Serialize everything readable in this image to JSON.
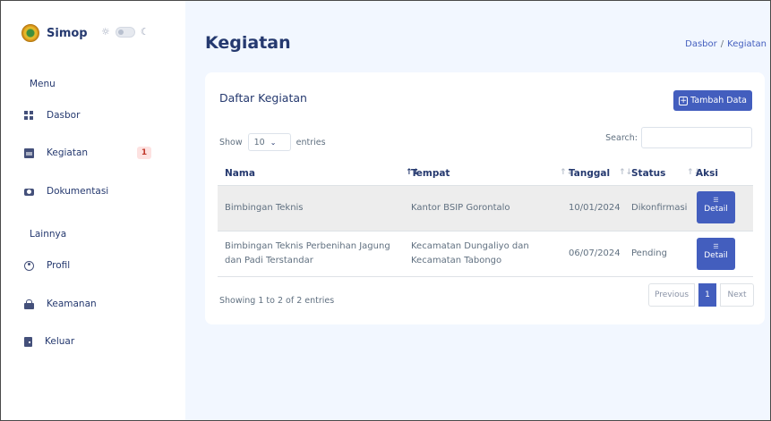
{
  "brand": {
    "name": "Simop",
    "sun_icon": "sun-icon",
    "moon_icon": "moon-icon"
  },
  "sidebar": {
    "menu_title": "Menu",
    "other_title": "Lainnya",
    "items": [
      {
        "label": "Dasbor",
        "icon": "dashboard-grid-icon"
      },
      {
        "label": "Kegiatan",
        "icon": "calendar-icon",
        "badge": "1"
      },
      {
        "label": "Dokumentasi",
        "icon": "camera-icon"
      },
      {
        "label": "Profil",
        "icon": "user-circle-icon"
      },
      {
        "label": "Keamanan",
        "icon": "lock-icon"
      },
      {
        "label": "Keluar",
        "icon": "door-icon"
      }
    ]
  },
  "header": {
    "title": "Kegiatan",
    "breadcrumb": [
      "Dasbor",
      "Kegiatan"
    ],
    "breadcrumb_sep": "/"
  },
  "card": {
    "title": "Daftar Kegiatan",
    "add_button": "Tambah Data",
    "show_label": "Show",
    "entries_value": "10",
    "entries_label": "entries",
    "search_label": "Search:",
    "search_value": ""
  },
  "table": {
    "columns": [
      "Nama",
      "Tempat",
      "Tanggal",
      "Status",
      "Aksi"
    ],
    "rows": [
      {
        "nama": "Bimbingan Teknis",
        "tempat": "Kantor BSIP Gorontalo",
        "tanggal": "10/01/2024",
        "status": "Dikonfirmasi",
        "aksi": "Detail"
      },
      {
        "nama": "Bimbingan Teknis Perbenihan Jagung dan Padi Terstandar",
        "tempat": "Kecamatan Dungaliyo dan Kecamatan Tabongo",
        "tanggal": "06/07/2024",
        "status": "Pending",
        "aksi": "Detail"
      }
    ],
    "info": "Showing 1 to 2 of 2 entries"
  },
  "pagination": {
    "previous": "Previous",
    "current": "1",
    "next": "Next"
  },
  "colors": {
    "primary": "#435ebe",
    "text": "#25396f",
    "background": "#f2f7ff",
    "badge_bg": "#fde2e1",
    "badge_text": "#c0392b"
  }
}
